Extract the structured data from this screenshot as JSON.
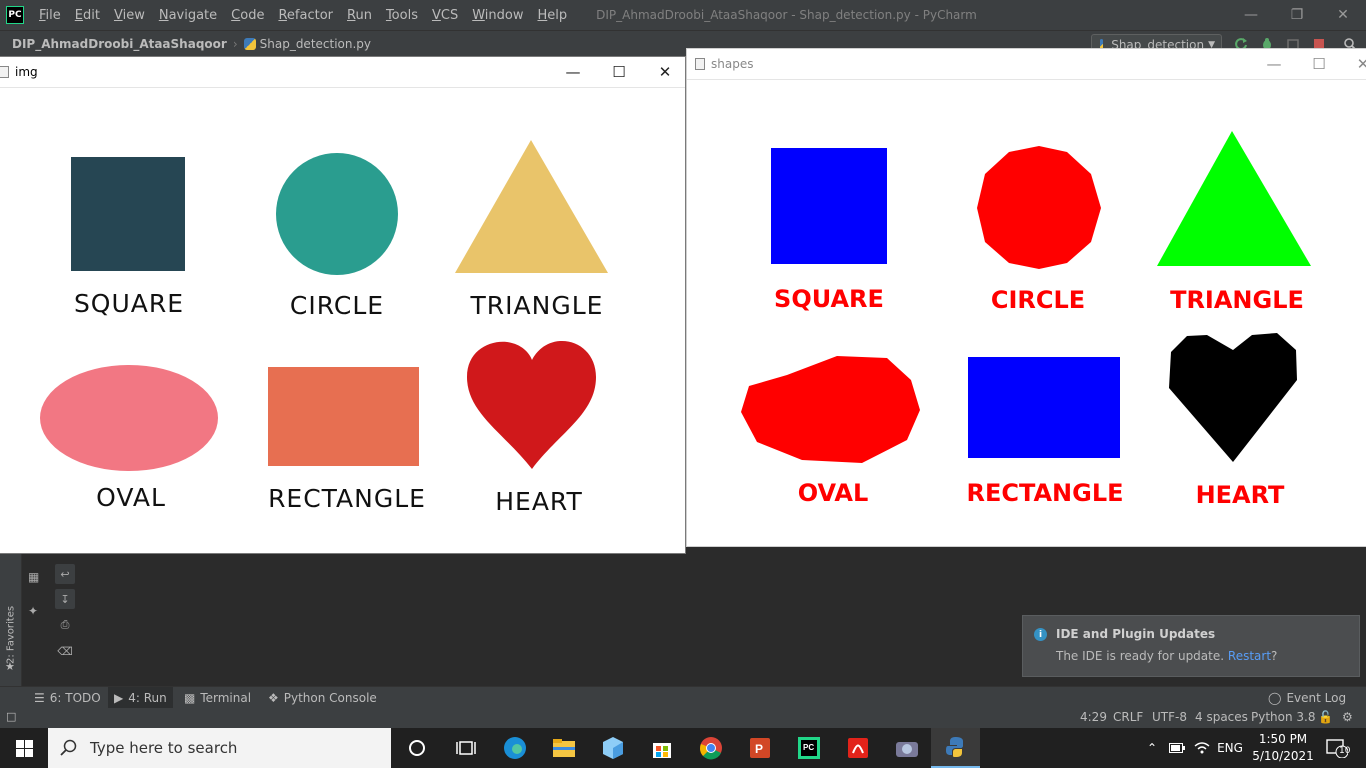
{
  "ide": {
    "logo_text": "PC",
    "menu": [
      "File",
      "Edit",
      "View",
      "Navigate",
      "Code",
      "Refactor",
      "Run",
      "Tools",
      "VCS",
      "Window",
      "Help"
    ],
    "window_title": "DIP_AhmadDroobi_AtaaShaqoor - Shap_detection.py - PyCharm",
    "breadcrumb_project": "DIP_AhmadDroobi_AtaaShaqoor",
    "breadcrumb_file": "Shap_detection.py",
    "run_config": "Shap_detection"
  },
  "img_window": {
    "title": "img",
    "labels": [
      "SQUARE",
      "CIRCLE",
      "TRIANGLE",
      "OVAL",
      "RECTANGLE",
      "HEART"
    ],
    "colors": {
      "square": "#264653",
      "circle": "#2a9d8f",
      "triangle": "#e9c46a",
      "oval": "#f27783",
      "rectangle": "#e76f51",
      "heart": "#d0181b"
    }
  },
  "shapes_window": {
    "title": "shapes",
    "labels": [
      "SQUARE",
      "CIRCLE",
      "TRIANGLE",
      "OVAL",
      "RECTANGLE",
      "HEART"
    ],
    "colors": {
      "square": "#0000ff",
      "circle": "#ff0000",
      "triangle": "#00ff00",
      "oval": "#ff0000",
      "rectangle": "#0000ff",
      "heart": "#000000",
      "label": "#ff0000"
    }
  },
  "favorites_label": "2: Favorites",
  "notification": {
    "title": "IDE and Plugin Updates",
    "body": "The IDE is ready for update.",
    "link": "Restart",
    "suffix": "?"
  },
  "toolwindows": [
    {
      "label": "6: TODO",
      "icon": "list-icon"
    },
    {
      "label": "4: Run",
      "icon": "run-icon",
      "active": true
    },
    {
      "label": "Terminal",
      "icon": "terminal-icon"
    },
    {
      "label": "Python Console",
      "icon": "python-console-icon"
    }
  ],
  "event_log": "Event Log",
  "status": {
    "position": "4:29",
    "line_sep": "CRLF",
    "encoding": "UTF-8",
    "indent": "4 spaces",
    "interpreter": "Python 3.8"
  },
  "taskbar": {
    "search_placeholder": "Type here to search",
    "language": "ENG",
    "time": "1:50 PM",
    "date": "5/10/2021",
    "notification_count": "10"
  }
}
